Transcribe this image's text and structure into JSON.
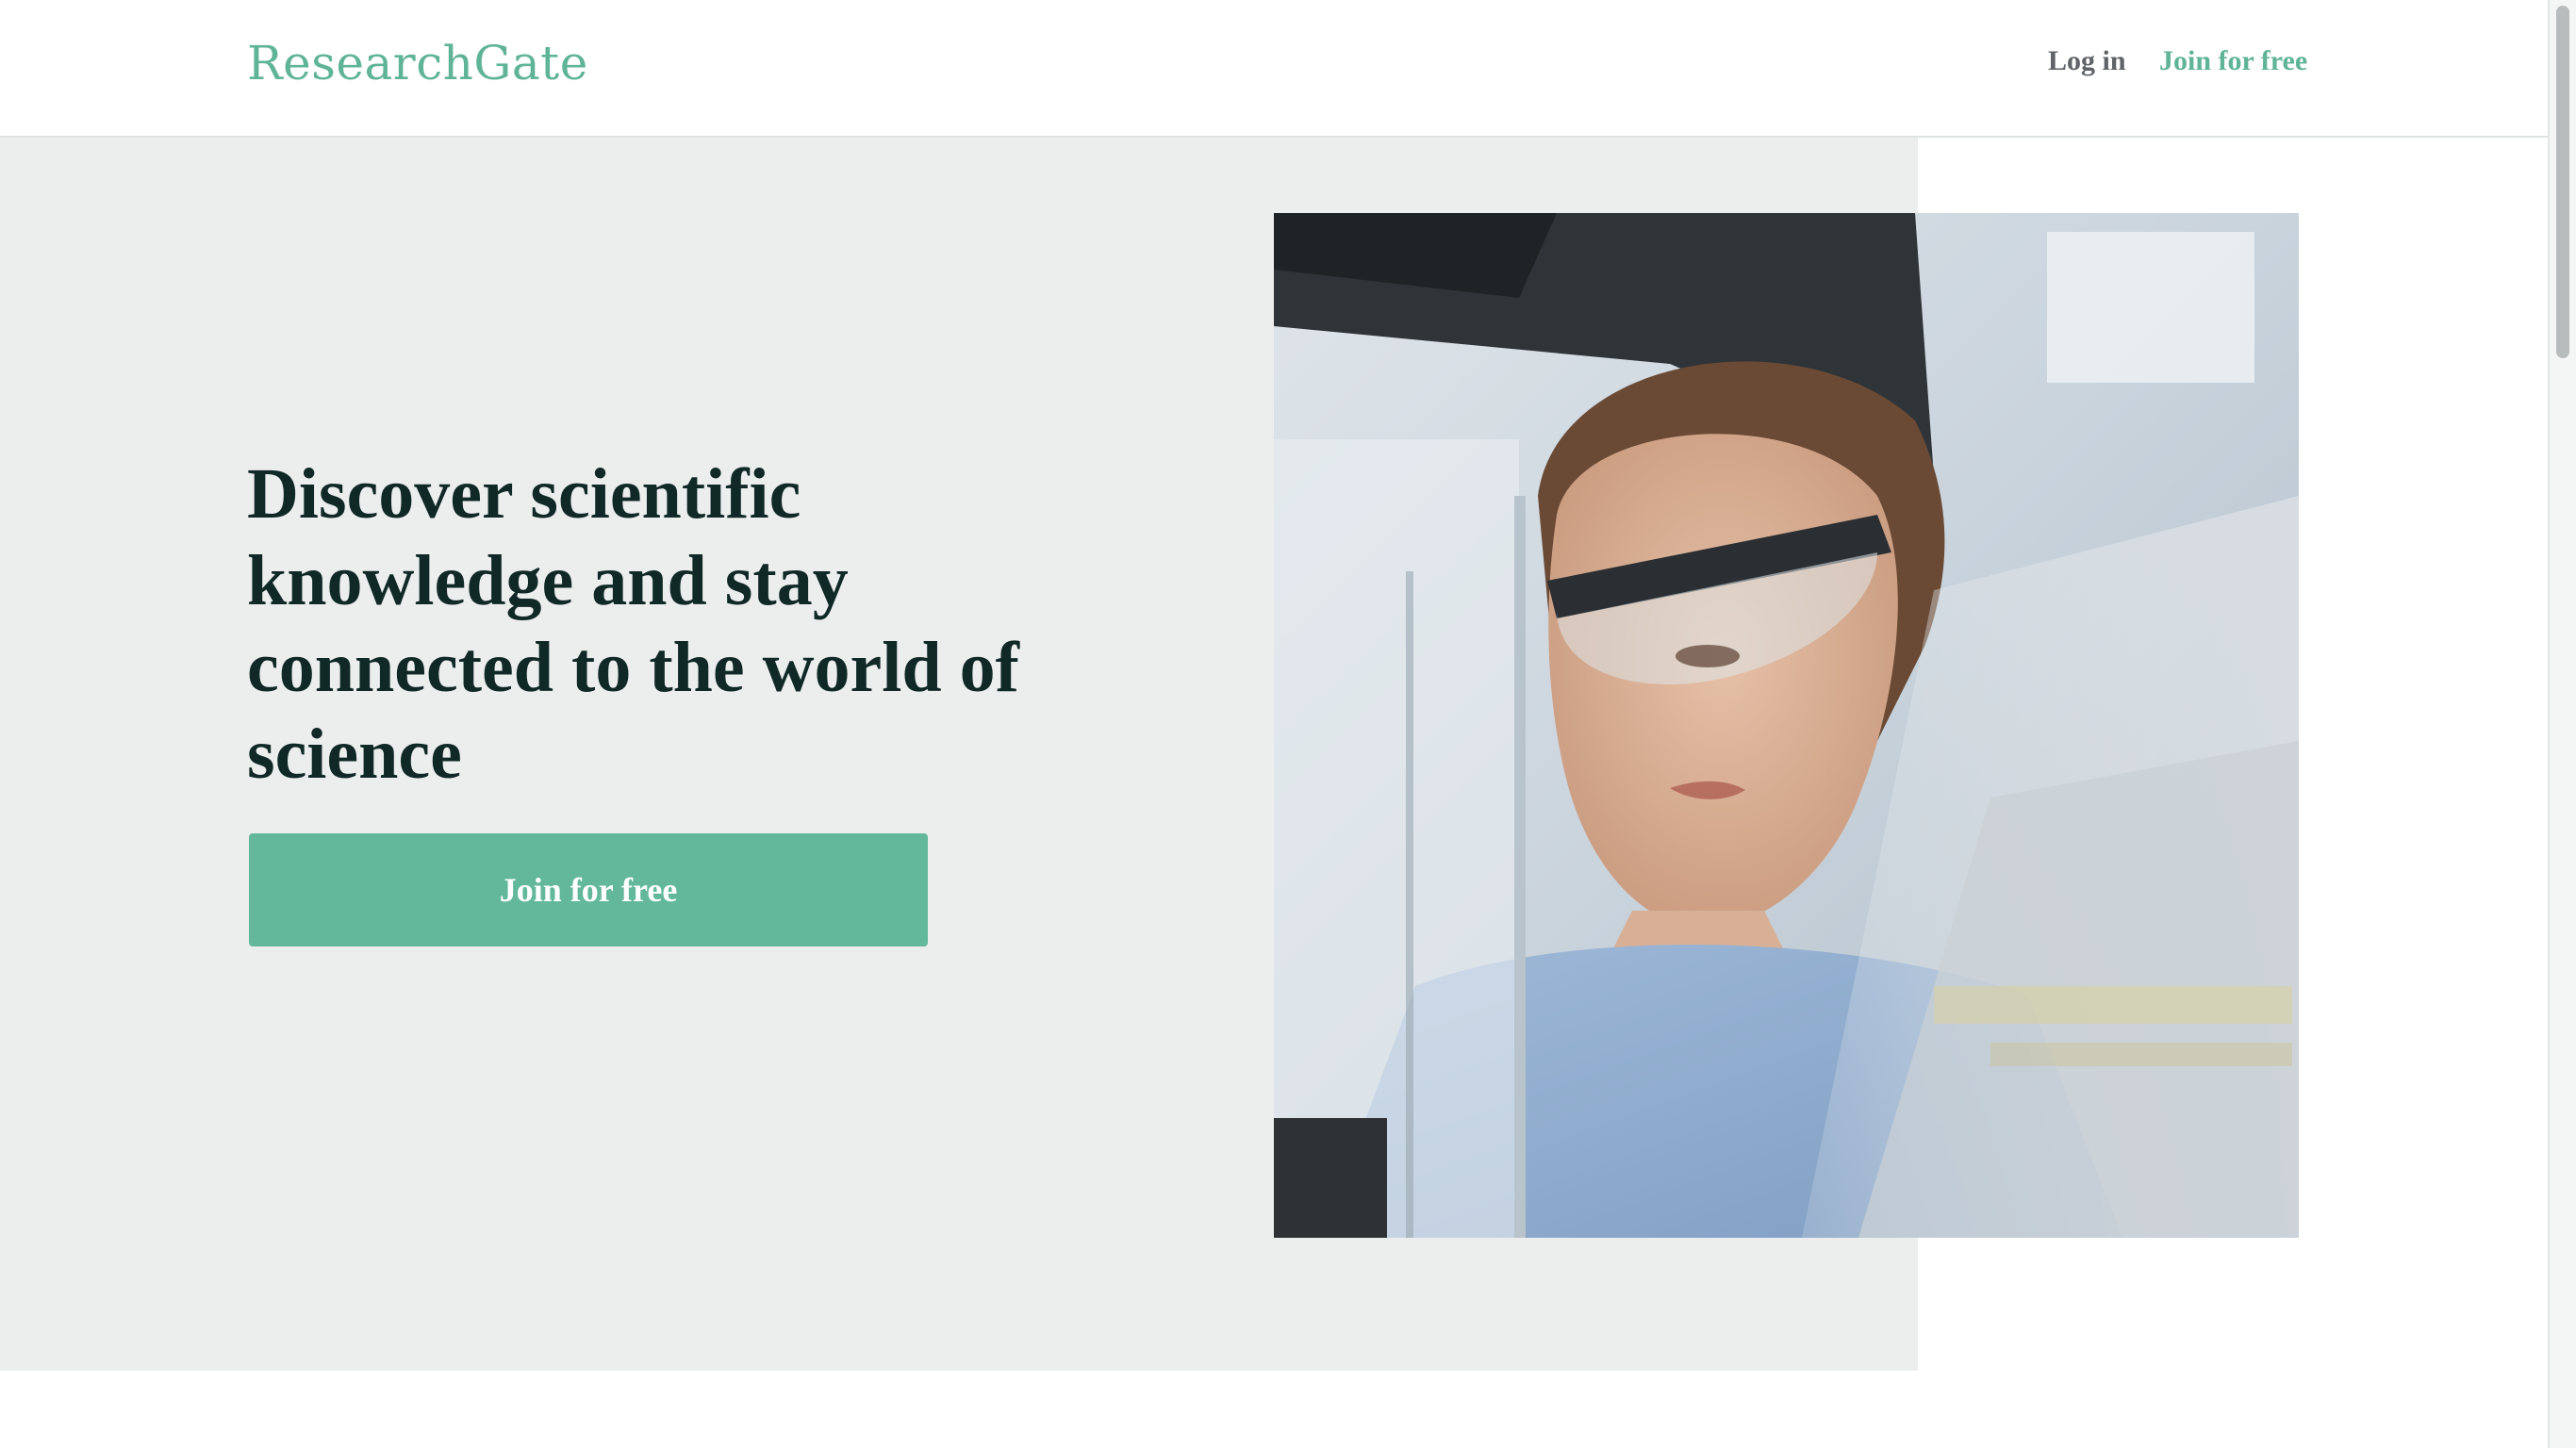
{
  "header": {
    "logo": "ResearchGate",
    "login_label": "Log in",
    "join_label": "Join for free"
  },
  "hero": {
    "title": "Discover scientific knowledge and stay connected to the world of science",
    "cta_label": "Join for free",
    "image_icon": "scientist-photo"
  },
  "colors": {
    "brand_green": "#5fb497",
    "button_green": "#63b89c",
    "hero_background": "#eceeee",
    "title_text": "#102926"
  }
}
